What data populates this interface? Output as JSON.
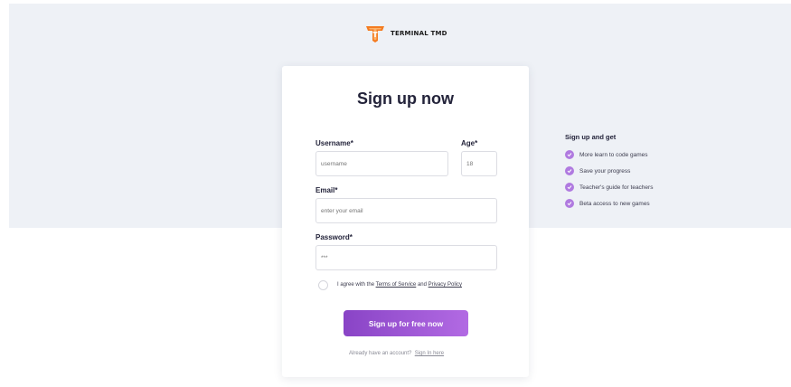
{
  "brand": {
    "name": "TERMINAL TMD",
    "logo_icon": "tmd-shield-logo",
    "accent": "#f47b20"
  },
  "form": {
    "title": "Sign up now",
    "username_label": "Username*",
    "username_placeholder": "username",
    "age_label": "Age*",
    "age_placeholder": "18",
    "email_label": "Email*",
    "email_placeholder": "enter your email",
    "password_label": "Password*",
    "password_placeholder": "***",
    "agree_prefix": "I agree with the ",
    "terms_link": "Terms of Service",
    "agree_middle": " and ",
    "privacy_link": "Privacy Policy",
    "submit_label": "Sign up for free now",
    "login_prompt": "Already have an account?",
    "signin_link": "Sign In here",
    "submit_colors": [
      "#8944c6",
      "#b26ae3"
    ]
  },
  "benefits": {
    "title": "Sign up and get",
    "items": [
      "More learn to code games",
      "Save your progress",
      "Teacher's guide for teachers",
      "Beta access to new games"
    ],
    "check_icon": "check-circle-icon",
    "check_color": "#b07ae0"
  }
}
